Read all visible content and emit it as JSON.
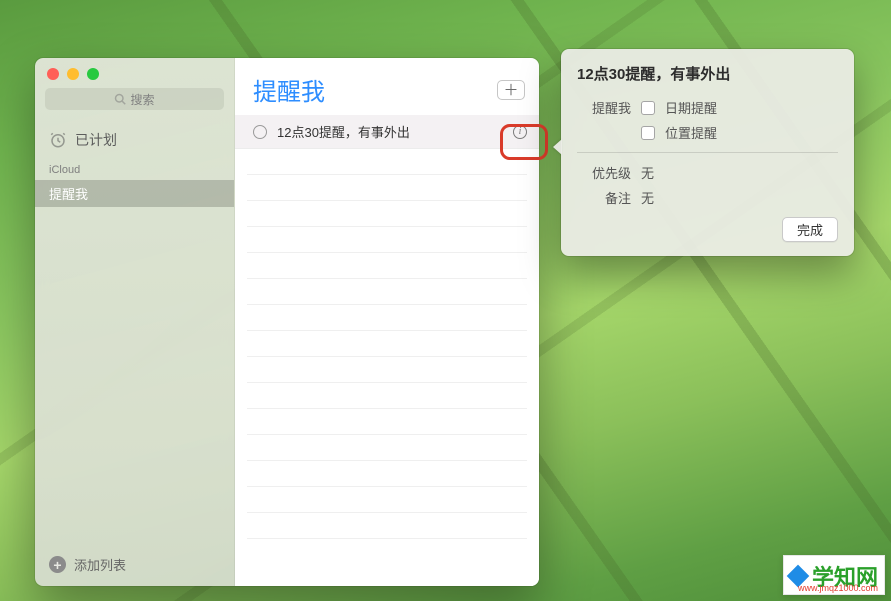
{
  "sidebar": {
    "search_placeholder": "搜索",
    "planned_label": "已计划",
    "account_label": "iCloud",
    "selected_list": "提醒我",
    "add_list_label": "添加列表"
  },
  "main": {
    "title": "提醒我",
    "add_button_label": "＋",
    "reminders": [
      {
        "text": "12点30提醒，有事外出"
      }
    ]
  },
  "popover": {
    "title": "12点30提醒，有事外出",
    "remind_me_label": "提醒我",
    "date_reminder_label": "日期提醒",
    "location_reminder_label": "位置提醒",
    "priority_label": "优先级",
    "priority_value": "无",
    "notes_label": "备注",
    "notes_value": "无",
    "done_label": "完成"
  },
  "watermark": {
    "brand": "学知网",
    "url": "www.jmqz1000.com"
  }
}
